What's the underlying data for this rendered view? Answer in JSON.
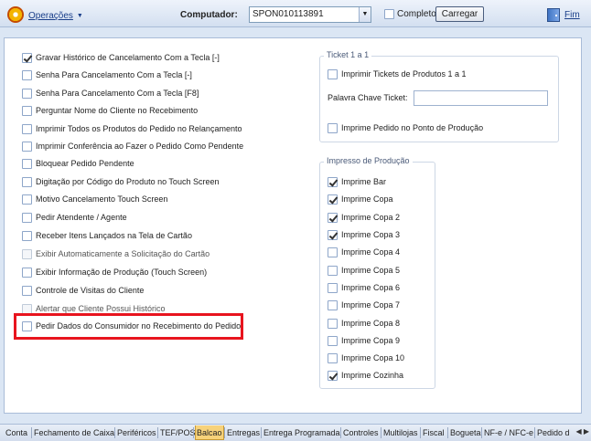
{
  "toolbar": {
    "operations": "Operações",
    "computer_label": "Computador:",
    "computer_value": "SPON010113891",
    "complete_label": "Completo",
    "complete_checked": false,
    "load_button": "Carregar",
    "exit_label": "Fim"
  },
  "left_items": [
    {
      "label": "Gravar Histórico de Cancelamento Com a Tecla [-]",
      "checked": true,
      "disabled": false
    },
    {
      "label": "Senha Para Cancelamento Com a Tecla [-]",
      "checked": false,
      "disabled": false
    },
    {
      "label": "Senha Para Cancelamento Com a Tecla [F8]",
      "checked": false,
      "disabled": false
    },
    {
      "label": "Perguntar Nome do Cliente no Recebimento",
      "checked": false,
      "disabled": false
    },
    {
      "label": "Imprimir Todos os Produtos do Pedido no Relançamento",
      "checked": false,
      "disabled": false
    },
    {
      "label": "Imprimir Conferência ao Fazer o Pedido Como Pendente",
      "checked": false,
      "disabled": false
    },
    {
      "label": "Bloquear Pedido Pendente",
      "checked": false,
      "disabled": false
    },
    {
      "label": "Digitação por Código do Produto no Touch Screen",
      "checked": false,
      "disabled": false
    },
    {
      "label": "Motivo Cancelamento Touch Screen",
      "checked": false,
      "disabled": false
    },
    {
      "label": "Pedir Atendente / Agente",
      "checked": false,
      "disabled": false
    },
    {
      "label": "Receber Itens Lançados na Tela de Cartão",
      "checked": false,
      "disabled": false
    },
    {
      "label": "Exibir Automaticamente a Solicitação do Cartão",
      "checked": false,
      "disabled": true
    },
    {
      "label": "Exibir Informação de Produção (Touch Screen)",
      "checked": false,
      "disabled": false
    },
    {
      "label": "Controle de Visitas do Cliente",
      "checked": false,
      "disabled": false
    },
    {
      "label": "Alertar que Cliente Possui Histórico",
      "checked": false,
      "disabled": true
    },
    {
      "label": "Pedir Dados do Consumidor no Recebimento do Pedido",
      "checked": false,
      "disabled": false
    }
  ],
  "ticket_group": {
    "title": "Ticket 1 a 1",
    "print_tickets": "Imprimir Tickets de Produtos 1 a 1",
    "keyword_label": "Palavra Chave Ticket:",
    "keyword_value": "",
    "print_point": "Imprime Pedido no Ponto de Produção"
  },
  "production_group": {
    "title": "Impresso de Produção",
    "items": [
      {
        "label": "Imprime Bar",
        "checked": true
      },
      {
        "label": "Imprime Copa",
        "checked": true
      },
      {
        "label": "Imprime Copa 2",
        "checked": true
      },
      {
        "label": "Imprime Copa 3",
        "checked": true
      },
      {
        "label": "Imprime Copa 4",
        "checked": false
      },
      {
        "label": "Imprime Copa 5",
        "checked": false
      },
      {
        "label": "Imprime Copa 6",
        "checked": false
      },
      {
        "label": "Imprime Copa 7",
        "checked": false
      },
      {
        "label": "Imprime Copa 8",
        "checked": false
      },
      {
        "label": "Imprime Copa 9",
        "checked": false
      },
      {
        "label": "Imprime Copa 10",
        "checked": false
      },
      {
        "label": "Imprime Cozinha",
        "checked": true
      }
    ]
  },
  "tabs": [
    {
      "label": "Conta",
      "active": false
    },
    {
      "label": "Fechamento de Caixa",
      "active": false
    },
    {
      "label": "Periféricos",
      "active": false
    },
    {
      "label": "TEF/POS",
      "active": false
    },
    {
      "label": "Balcao",
      "active": true
    },
    {
      "label": "Entregas",
      "active": false
    },
    {
      "label": "Entrega Programada",
      "active": false
    },
    {
      "label": "Controles",
      "active": false
    },
    {
      "label": "Multilojas",
      "active": false
    },
    {
      "label": "Fiscal",
      "active": false
    },
    {
      "label": "Bogueta",
      "active": false
    },
    {
      "label": "NF-e / NFC-e",
      "active": false
    },
    {
      "label": "Pedido d",
      "active": false
    }
  ],
  "colors": {
    "highlight": "#e8141e",
    "active_tab": "#f7d27a",
    "link": "#1a3f8a"
  }
}
